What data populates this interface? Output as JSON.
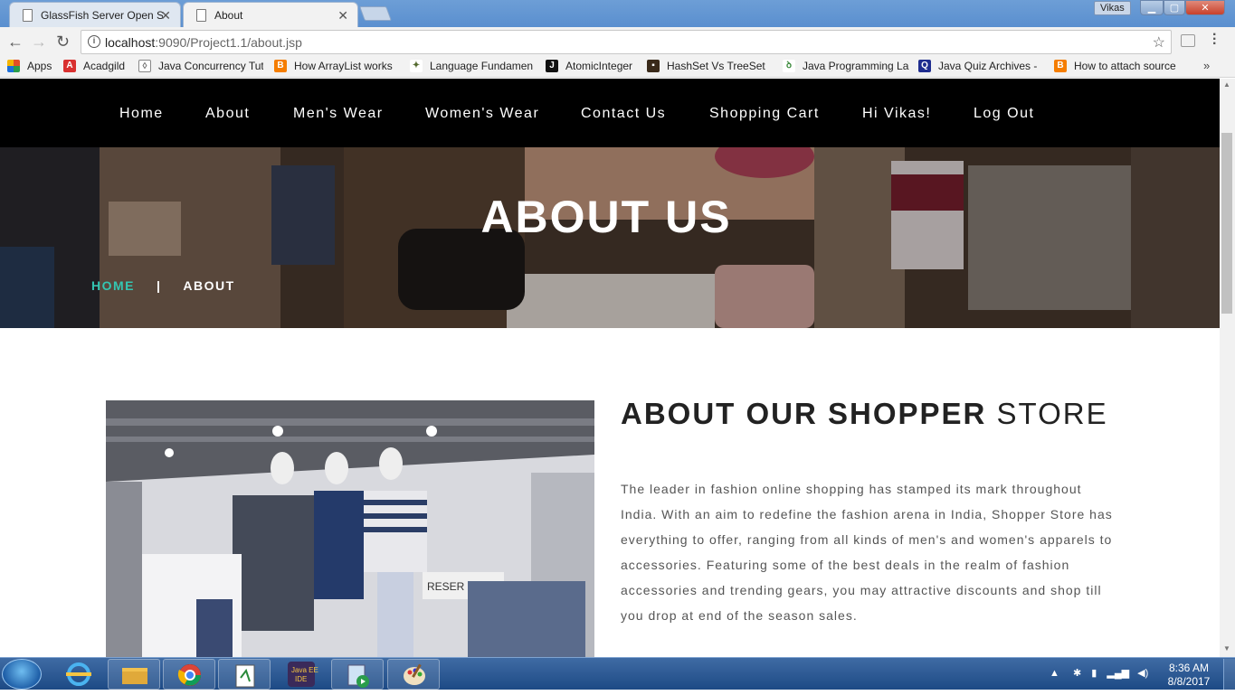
{
  "browser": {
    "tabs": [
      {
        "label": "GlassFish Server Open Sc"
      },
      {
        "label": "About"
      }
    ],
    "user_badge": "Vikas",
    "url_host": "localhost",
    "url_rest": ":9090/Project1.1/about.jsp",
    "bookmarks": [
      {
        "label": "Apps",
        "icon": "apps-grid-icon",
        "color": "#e34f26"
      },
      {
        "label": "Acadgild",
        "icon": "acadgild-icon",
        "color": "#d9302f"
      },
      {
        "label": "Java Concurrency Tut",
        "icon": "bookmark-icon",
        "color": "#888888"
      },
      {
        "label": "How ArrayList works",
        "icon": "blogger-icon",
        "color": "#f57d00"
      },
      {
        "label": "Language Fundamen",
        "icon": "tree-icon",
        "color": "#556b2f"
      },
      {
        "label": "AtomicInteger",
        "icon": "j-icon",
        "color": "#111111"
      },
      {
        "label": "HashSet Vs TreeSet",
        "icon": "page-icon",
        "color": "#3a2a1a"
      },
      {
        "label": "Java Programming La",
        "icon": "tree-icon",
        "color": "#3d8b3d"
      },
      {
        "label": "Java Quiz Archives -",
        "icon": "quiz-icon",
        "color": "#1f2d8f"
      },
      {
        "label": "How to attach source",
        "icon": "blogger-icon",
        "color": "#f57d00"
      }
    ]
  },
  "site": {
    "nav": [
      "Home",
      "About",
      "Men's Wear",
      "Women's Wear",
      "Contact Us",
      "Shopping Cart",
      "Hi Vikas!",
      "Log Out"
    ],
    "hero_title": "ABOUT US",
    "breadcrumb_home": "HOME",
    "breadcrumb_sep": "|",
    "breadcrumb_current": "ABOUT",
    "about_title_bold": "ABOUT OUR SHOPPER",
    "about_title_light": " STORE",
    "about_text": "The leader in fashion online shopping has stamped its mark throughout India. With an aim to redefine the fashion arena in India, Shopper Store has everything to offer, ranging from all kinds of men's and women's apparels to accessories. Featuring some of the best deals in the realm of fashion accessories and trending gears, you may attractive discounts and shop till you drop at end of the season sales.",
    "store_sign": "RESER"
  },
  "taskbar": {
    "time": "8:36 AM",
    "date": "8/8/2017"
  },
  "colors": {
    "accent": "#33c6b2",
    "nav_bg": "#000000"
  }
}
